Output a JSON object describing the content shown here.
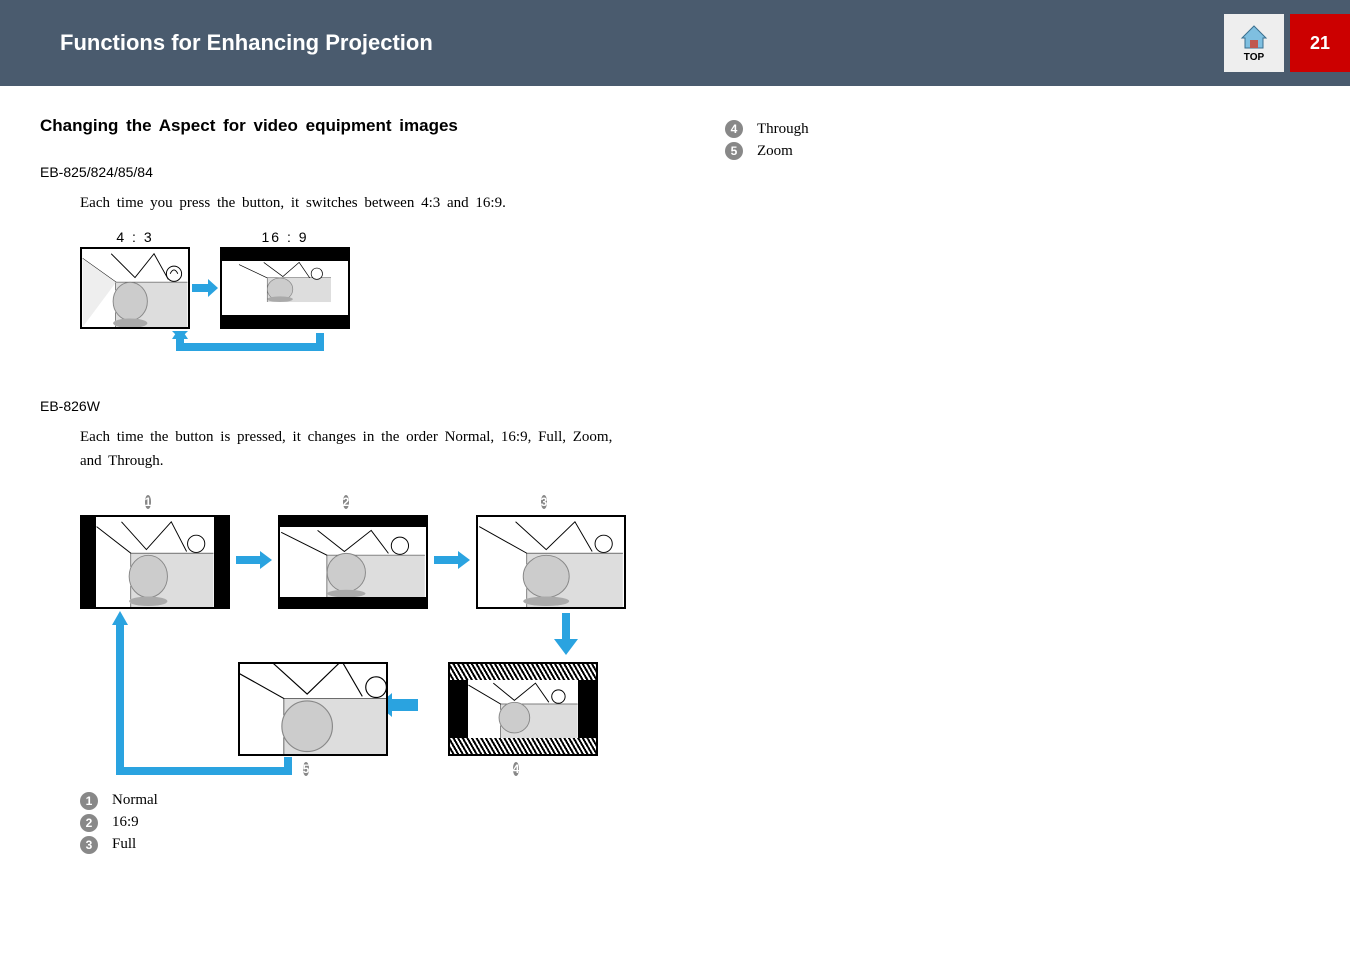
{
  "header": {
    "title": "Functions for Enhancing Projection",
    "top_label": "TOP",
    "page_number": "21"
  },
  "section": {
    "title": "Changing the Aspect for video equipment images"
  },
  "model1": {
    "heading": "EB-825/824/85/84",
    "body": "Each time you press the button, it switches between 4:3 and 16:9.",
    "ratio_a": "4 : 3",
    "ratio_b": "16 : 9"
  },
  "model2": {
    "heading": "EB-826W",
    "body": "Each time the button is pressed, it changes in the order Normal, 16:9, Full, Zoom, and Through."
  },
  "legend": {
    "1": "Normal",
    "2": "16:9",
    "3": "Full",
    "4": "Through",
    "5": "Zoom"
  }
}
